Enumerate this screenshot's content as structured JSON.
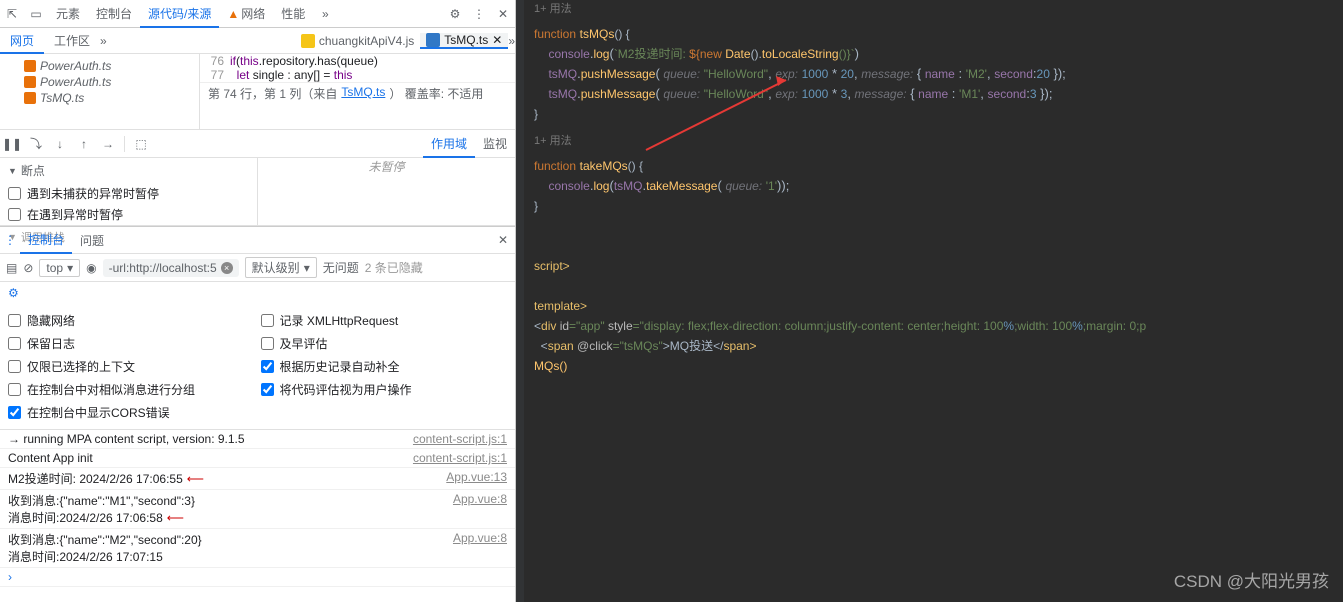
{
  "devtools": {
    "tabs": [
      "元素",
      "控制台",
      "源代码/来源",
      "网络",
      "性能"
    ],
    "activeTab": "源代码/来源",
    "networkWarn": "▲"
  },
  "sources": {
    "subTabs": {
      "page": "网页",
      "workspace": "工作区"
    },
    "openFiles": {
      "f1": "chuangkitApiV4.js",
      "f2": "TsMQ.ts"
    },
    "tree": {
      "f1": "PowerAuth.ts",
      "f2": "PowerAuth.ts",
      "f3": "TsMQ.ts"
    },
    "code": {
      "ln76": "76",
      "ln77": "77",
      "l76": "if(this.repository.has(queue)",
      "l77": "let single : any[] = this"
    },
    "status": {
      "prefix": "第 74 行，第 1 列（来自 ",
      "link": "TsMQ.ts",
      "suffix": "）  覆盖率: 不适用"
    }
  },
  "scope": {
    "tab1": "作用域",
    "tab2": "监视",
    "placeholder": "未暂停"
  },
  "breakpoints": {
    "header": "断点",
    "b1": "遇到未捕获的异常时暂停",
    "b2": "在遇到异常时暂停",
    "more": "调用堆栈"
  },
  "drawer": {
    "console": "控制台",
    "issues": "问题"
  },
  "consoleBar": {
    "context": "top",
    "filter": "-url:http://localhost:5",
    "level": "默认级别",
    "noissue": "无问题",
    "hidden": "2 条已隐藏"
  },
  "consoleSettings": {
    "hideNetwork": "隐藏网络",
    "logXhr": "记录 XMLHttpRequest",
    "preserve": "保留日志",
    "eager": "及早评估",
    "selectedOnly": "仅限已选择的上下文",
    "autocomplete": "根据历史记录自动补全",
    "groupSimilar": "在控制台中对相似消息进行分组",
    "userActivation": "将代码评估视为用户操作",
    "corsErrors": "在控制台中显示CORS错误"
  },
  "logs": [
    {
      "msg": "→ running MPA content script, version: 9.1.5",
      "src": "content-script.js:1"
    },
    {
      "msg": "Content App init",
      "src": "content-script.js:1"
    },
    {
      "msg": "M2投递时间: 2024/2/26 17:06:55",
      "src": "App.vue:13",
      "arrow": true
    },
    {
      "msg": "收到消息:{\"name\":\"M1\",\"second\":3}",
      "sub": "消息时间:2024/2/26 17:06:58",
      "src": "App.vue:8",
      "arrow": true
    },
    {
      "msg": "收到消息:{\"name\":\"M2\",\"second\":20}",
      "sub": "消息时间:2024/2/26 17:07:15",
      "src": "App.vue:8"
    }
  ],
  "editor": {
    "usage": "1+ 用法",
    "fn1": "tsMQs",
    "fn2": "takeMQs",
    "logTmpl_a": "`M2投递时间: ",
    "logTmpl_b": "${",
    "logTmpl_c": "new ",
    "logTmpl_d": "Date",
    "logTmpl_e": "().",
    "logTmpl_f": "toLocaleString",
    "logTmpl_g": "()}`",
    "push": "pushMessage",
    "take": "takeMessage",
    "q": "queue:",
    "exp": "exp:",
    "msg": "message:",
    "name": "name",
    "sec": "second",
    "hello": "\"HelloWord\"",
    "n1000": "1000",
    "n20": "20",
    "n3": "3",
    "m2": "'M2'",
    "m1": "'M1'",
    "q1": "'1'",
    "scriptEnd": "script>",
    "tmplEnd": "template>",
    "divLine_a": "<",
    "divLine_b": "div ",
    "divLine_c": "id",
    "divLine_d": "=\"app\" ",
    "divLine_e": "style",
    "divLine_f": "=\"display: flex;flex-direction: column;justify-content: center;height: 100",
    "divLine_g": "%;width: 100",
    "divLine_h": "%;margin: 0;p",
    "spanLine_a": "  <",
    "spanLine_b": "span ",
    "spanLine_c": "@click",
    "spanLine_d": "=\"tsMQs\"",
    "spanLine_e": ">MQ投送</",
    "spanLine_f": "span>",
    "mqsCall": "MQs()"
  },
  "watermark": "CSDN @大阳光男孩"
}
